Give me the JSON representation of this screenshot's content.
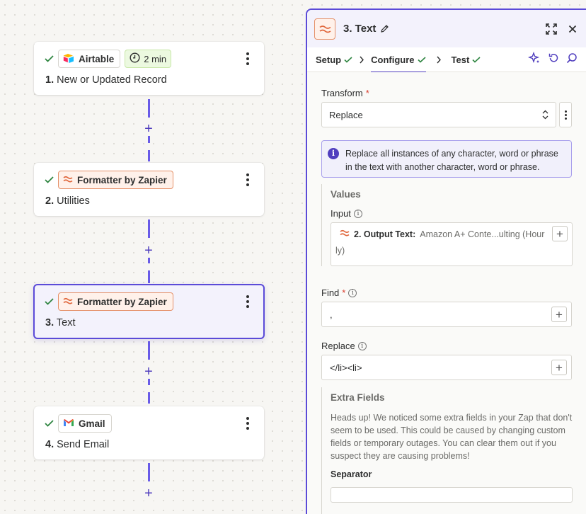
{
  "canvas": {
    "steps": [
      {
        "app": "Airtable",
        "delay": "2 min",
        "number": "1.",
        "title": "New or Updated Record"
      },
      {
        "app": "Formatter by Zapier",
        "number": "2.",
        "title": "Utilities"
      },
      {
        "app": "Formatter by Zapier",
        "number": "3.",
        "title": "Text"
      },
      {
        "app": "Gmail",
        "number": "4.",
        "title": "Send Email"
      }
    ],
    "add_label": "+"
  },
  "panel": {
    "title": "3. Text",
    "tabs": [
      {
        "label": "Setup"
      },
      {
        "label": "Configure"
      },
      {
        "label": "Test"
      }
    ],
    "transform": {
      "label": "Transform",
      "required": "*",
      "value": "Replace"
    },
    "callout": "Replace all instances of any character, word or phrase in the text with another character, word or phrase.",
    "values": {
      "title": "Values",
      "input_label": "Input",
      "pill_label": "2. Output Text:",
      "pill_value": "Amazon A+ Conte...ulting (Hour",
      "pill_wrap": "ly)"
    },
    "find": {
      "label": "Find",
      "required": "*",
      "value": ","
    },
    "replace": {
      "label": "Replace",
      "value": "</li><li>"
    },
    "extra": {
      "title": "Extra Fields",
      "text": "Heads up! We noticed some extra fields in your Zap that don't seem to be used. This could be caused by changing custom fields or temporary outages. You can clear them out if you suspect they are causing problems!",
      "separator_label": "Separator",
      "separator_value": ""
    }
  },
  "colors": {
    "accent": "#503ebe",
    "selected_border": "#5b4bd8",
    "success": "#2e8540",
    "formatter_orange": "#e0653a",
    "required": "#d93d2d"
  },
  "icons": {
    "check": "check-icon",
    "formatter": "formatter-icon",
    "airtable": "airtable-logo-icon",
    "gmail": "gmail-logo-icon",
    "clock": "clock-icon"
  }
}
